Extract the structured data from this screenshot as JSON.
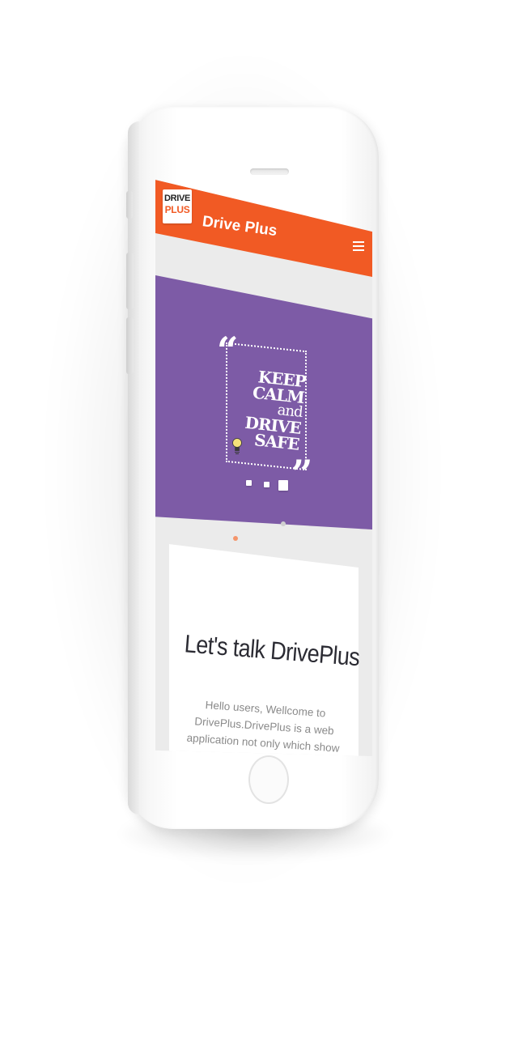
{
  "app": {
    "title": "Drive Plus",
    "logo_top": "DRIVE",
    "logo_bottom": "PLUS",
    "accent_color": "#f15a24",
    "banner_color": "#7d5ba6"
  },
  "header": {
    "menu_icon": "hamburger-menu-icon"
  },
  "banner": {
    "lines": [
      "KEEP",
      "CALM",
      "and",
      "DRIVE",
      "SAFE"
    ],
    "open_quote": "“",
    "close_quote": "”",
    "decoration_icon": "lightbulb-icon",
    "carousel_dot_count": 3,
    "active_dot_index": 2
  },
  "intro_card": {
    "title": "Let's talk DrivePlus",
    "body": "Hello users, Wellcome to DrivePlus.DrivePlus is a web application not only which show simple details it is"
  }
}
